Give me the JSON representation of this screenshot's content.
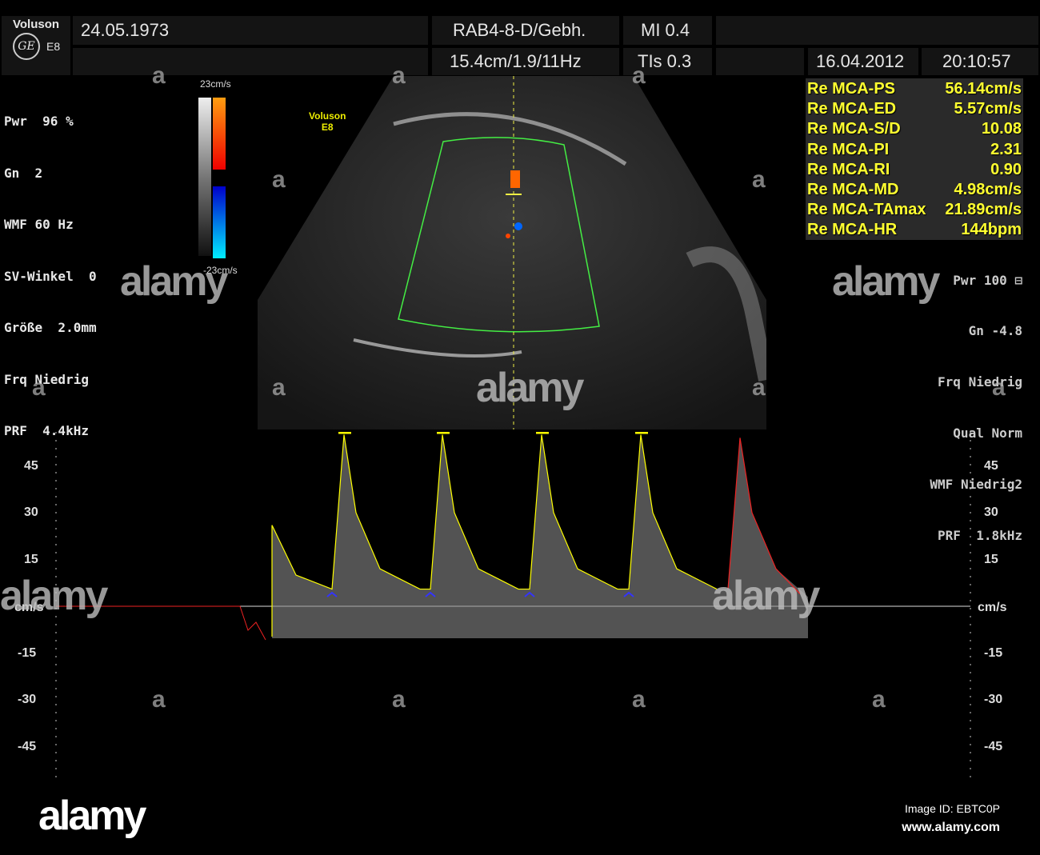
{
  "header": {
    "brand": "Voluson",
    "model": "E8",
    "logo": "GE",
    "patient_date": "24.05.1973",
    "probe": "RAB4-8-D/Gebh.",
    "mi": "MI  0.4",
    "depth": "15.4cm/1.9/11Hz",
    "tis": "TIs  0.3",
    "date": "16.04.2012",
    "time": "20:10:57"
  },
  "left_params": [
    "Pwr  96 %",
    "Gn  2",
    "WMF 60 Hz",
    "SV-Winkel  0",
    "Größe  2.0mm",
    "Frq Niedrig",
    "PRF  4.4kHz"
  ],
  "color_scale": {
    "top": "23cm/s",
    "bottom": "-23cm/s"
  },
  "image_label": {
    "brand": "Voluson",
    "model": "E8"
  },
  "measurements": [
    {
      "label": "Re MCA-PS",
      "value": "56.14cm/s"
    },
    {
      "label": "Re MCA-ED",
      "value": "5.57cm/s"
    },
    {
      "label": "Re MCA-S/D",
      "value": "10.08"
    },
    {
      "label": "Re MCA-PI",
      "value": "2.31"
    },
    {
      "label": "Re MCA-RI",
      "value": "0.90"
    },
    {
      "label": "Re MCA-MD",
      "value": "4.98cm/s"
    },
    {
      "label": "Re MCA-TAmax",
      "value": "21.89cm/s"
    },
    {
      "label": "Re MCA-HR",
      "value": "144bpm"
    }
  ],
  "right_params": [
    "Pwr 100 ⊟",
    "Gn -4.8",
    "Frq Niedrig",
    "Qual Norm",
    "WMF Niedrig2",
    "PRF  1.8kHz"
  ],
  "doppler": {
    "unit": "cm/s",
    "ticks": [
      "45",
      "30",
      "15",
      "-15",
      "-30",
      "-45"
    ],
    "tick_values": [
      45,
      30,
      15,
      -15,
      -30,
      -45
    ],
    "peaks_cm_s": [
      55,
      55,
      55,
      55,
      54
    ],
    "end_diastolic_cm_s": 5.5
  },
  "watermark": {
    "small": "a",
    "brand": "alamy",
    "image_id": "Image ID: EBTC0P",
    "url": "www.alamy.com"
  }
}
